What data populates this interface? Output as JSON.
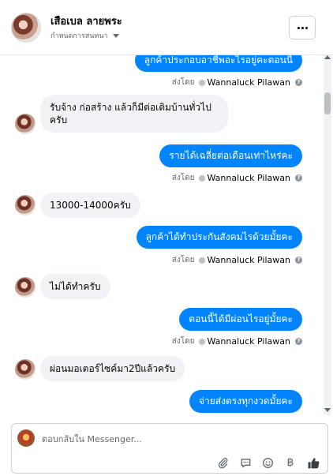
{
  "header": {
    "contact_name": "เสือเบล ลายพระ",
    "subtitle": "กำหนดการสนทนา",
    "more_label": "···"
  },
  "thread": {
    "sent_prefix": "ส่งโดย",
    "help_mark": "?",
    "messages": [
      {
        "direction": "out",
        "text": "ลูกค้าประกอบอาชีพอะไรอยู่คะตอนนี้",
        "sent_by": "Wannaluck Pilawan"
      },
      {
        "direction": "in",
        "text": "รับจ้าง ก่อสร้าง แล้วก็มีต่อเติมบ้านทั่วไป ครับ"
      },
      {
        "direction": "out",
        "text": "รายได้เฉลี่ยต่อเดือนเท่าไหร่คะ",
        "sent_by": "Wannaluck Pilawan"
      },
      {
        "direction": "in",
        "text": "13000-14000ครับ"
      },
      {
        "direction": "out",
        "text": "ลูกค้าได้ทำประกันสังคมไรด้วยมั้ยคะ",
        "sent_by": "Wannaluck Pilawan"
      },
      {
        "direction": "in",
        "text": "ไม่ได้ทำครับ"
      },
      {
        "direction": "out",
        "text": "ตอนนี้ได้มีผ่อนไรอยู่มั้ยคะ",
        "sent_by": "Wannaluck Pilawan"
      },
      {
        "direction": "in",
        "text": "ผ่อนมอเตอร์ไซค์มา2ปีแล้วครับ"
      },
      {
        "direction": "out",
        "text": "จ่ายส่งตรงทุกงวดมั้ยคะ"
      }
    ]
  },
  "composer": {
    "placeholder": "ตอบกลับใน Messenger...",
    "icons": [
      "paperclip-icon",
      "chat-bubble-icon",
      "emoji-icon",
      "baht-icon",
      "thumbs-up-icon"
    ],
    "baht_glyph": "฿"
  },
  "colors": {
    "outgoing_bubble": "#0084ff",
    "incoming_bubble": "#f0f2f5",
    "text_secondary": "#65676b"
  }
}
